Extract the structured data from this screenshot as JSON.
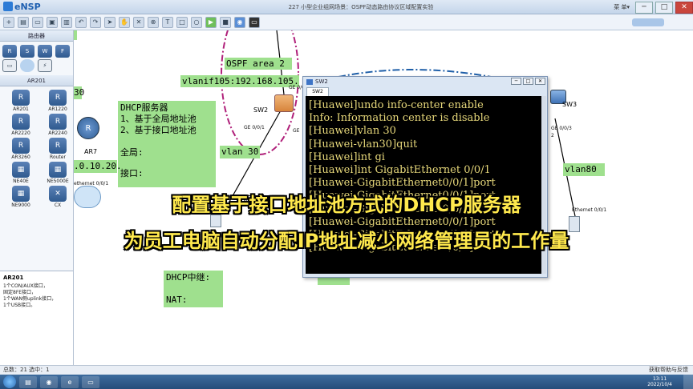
{
  "app": {
    "name": "eNSP",
    "window_title": "227 小型企业组网场景：OSPF动态路由协议区域配置实验",
    "menu_label": "菜 单▾",
    "win_controls": [
      "─",
      "□",
      "✕"
    ]
  },
  "left_panel": {
    "router_section_title": "路由器",
    "ar201_section_title": "AR201",
    "devices": [
      {
        "label": "AR201",
        "icon": "router-icon"
      },
      {
        "label": "AR1220",
        "icon": "router-icon"
      },
      {
        "label": "AR2220",
        "icon": "router-icon"
      },
      {
        "label": "AR2240",
        "icon": "router-icon"
      },
      {
        "label": "AR3260",
        "icon": "router-icon"
      },
      {
        "label": "Router",
        "icon": "router-icon"
      },
      {
        "label": "NE40E",
        "icon": "router-icon"
      },
      {
        "label": "NE5000E",
        "icon": "router-icon"
      },
      {
        "label": "NE9000",
        "icon": "router-icon"
      },
      {
        "label": "CX",
        "icon": "router-icon"
      }
    ],
    "description": {
      "title": "AR201",
      "lines": [
        "1个CON/AUX接口，",
        "固定8FE接口，",
        "1个WAN侧uplink接口，",
        "1个USB接口。"
      ]
    }
  },
  "canvas": {
    "ospf_area": "OSPF area 2",
    "vlanif_text": "vlanif105:192.168.105.",
    "dhcp_note": {
      "title": "DHCP服务器",
      "line1": "1、基于全局地址池",
      "line2": "2、基于接口地址池",
      "global": "全局:",
      "iface": "接口:"
    },
    "vlan30_note": "vlan 30",
    "ip_partial": ".0.10.20.",
    "thirty_partial": "30",
    "vlan80_note": "vlan80",
    "dhcp_relay_note": {
      "line1": "DHCP中继:",
      "line2": "NAT:"
    },
    "nodes": {
      "ar7": "AR7",
      "sw2": "SW2",
      "sw3": "SW3",
      "ge001_a": "GE 0/0/1",
      "ge0_partial": "GE",
      "ge003": "GE 0/0/3",
      "ge_two": "2",
      "eth001_left": "ethernet 0/0/1",
      "eth001_right": "Ethernet 0/0/1",
      "ge002_top": "GE 0/0/2"
    }
  },
  "terminal": {
    "title": "SW2",
    "tab": "SW2",
    "lines": [
      "[Huawei]undo info-center enable",
      "Info: Information center is disable",
      "[Huawei]vlan 30",
      "[Huawei-vlan30]quit",
      "[Huawei]int gi",
      "[Huawei]int GigabitEthernet 0/0/1",
      "[Huawei-GigabitEthernet0/0/1]port",
      "[Huawei-GigabitEthernet0/0/1]port",
      "[Huawei-GigabitEthernet0/0/1]port",
      "[Huawei-GigabitEthernet0/0/1]port",
      "[Huawei-GigabitEthernet0/0/1]port",
      "[Huawei-GigabitEthernet0/0/1]"
    ]
  },
  "captions": {
    "line1": "配置基于接口地址池方式的DHCP服务器",
    "line2": "为员工电脑自动分配IP地址减少网络管理员的工作量"
  },
  "statusbar": {
    "left": "总数：21  选中：1",
    "right": "获取帮助与反馈"
  },
  "taskbar": {
    "time": "13:11",
    "date": "2022/10/4"
  }
}
